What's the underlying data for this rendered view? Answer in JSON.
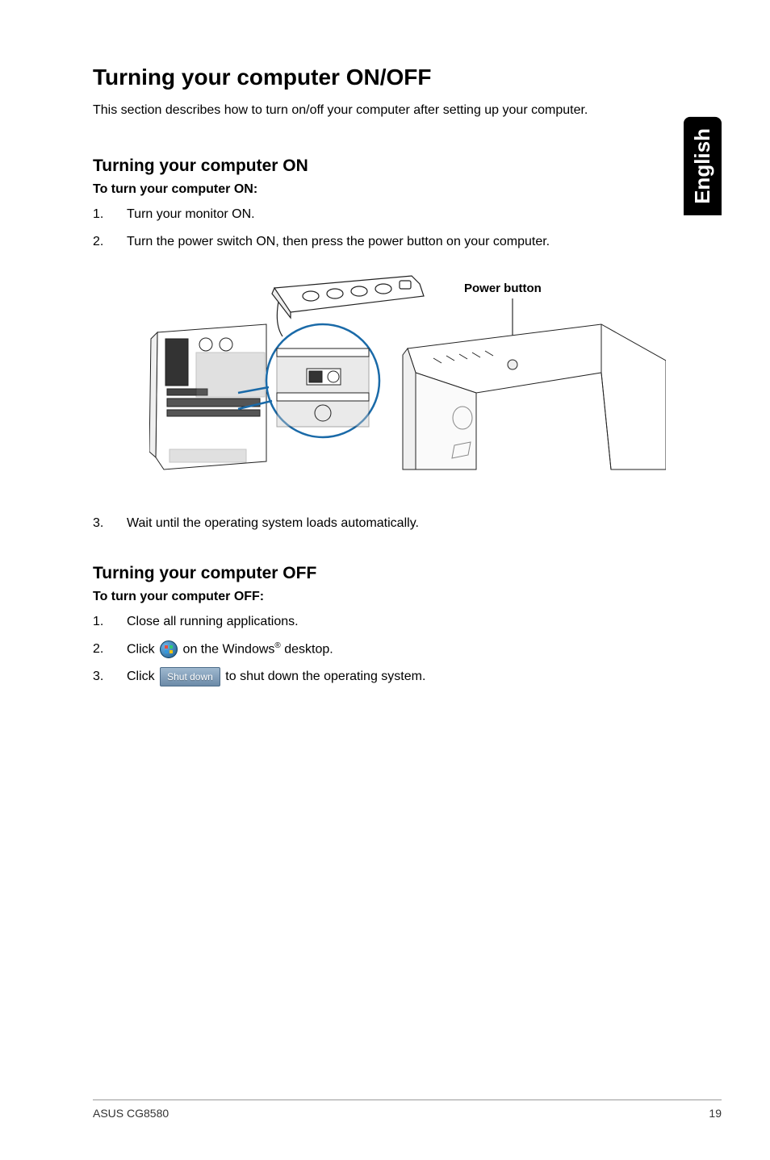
{
  "side_tab": "English",
  "title": "Turning your computer ON/OFF",
  "intro": "This section describes how to turn on/off your computer after setting up your computer.",
  "section_on": {
    "heading": "Turning your computer ON",
    "subheading": "To turn your computer ON:",
    "steps": [
      {
        "num": "1.",
        "text": "Turn your monitor ON."
      },
      {
        "num": "2.",
        "text": "Turn the power switch ON, then press the power button on your computer."
      },
      {
        "num": "3.",
        "text": "Wait until the operating system loads automatically."
      }
    ],
    "diagram_label": "Power button"
  },
  "section_off": {
    "heading": "Turning your computer OFF",
    "subheading": "To turn your computer OFF:",
    "steps": {
      "s1": {
        "num": "1.",
        "text": "Close all running applications."
      },
      "s2": {
        "num": "2.",
        "before": "Click ",
        "after_a": " on the Windows",
        "reg": "®",
        "after_b": " desktop."
      },
      "s3": {
        "num": "3.",
        "before": "Click ",
        "button": "Shut down",
        "after": " to shut down the operating system."
      }
    }
  },
  "footer": {
    "left": "ASUS CG8580",
    "right": "19"
  }
}
